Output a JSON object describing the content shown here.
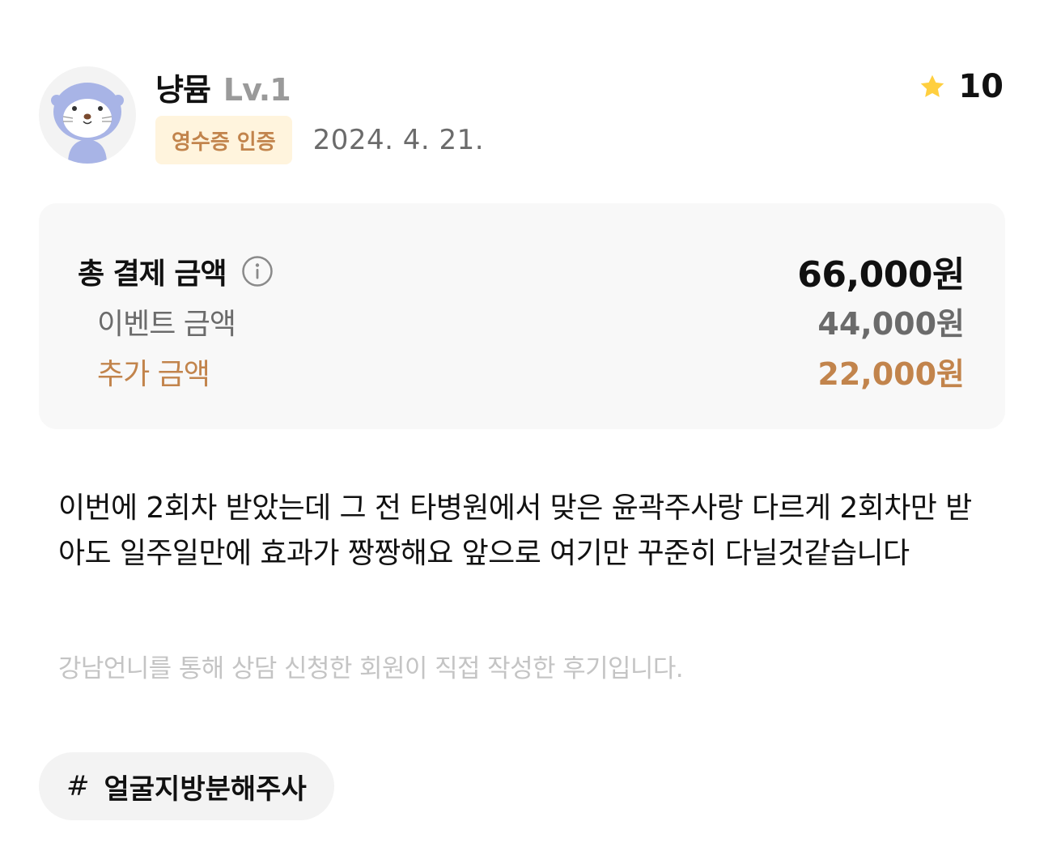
{
  "user": {
    "nickname": "냥뮴",
    "level": "Lv.1",
    "avatar_icon": "cat-character-avatar"
  },
  "badge": {
    "label": "영수증 인증"
  },
  "date": "2024. 4. 21.",
  "rating": {
    "icon": "star-icon",
    "value": "10"
  },
  "payment": {
    "total_label": "총 결제 금액",
    "total_value": "66,000원",
    "info_icon": "info-icon",
    "event_label": "이벤트 금액",
    "event_value": "44,000원",
    "extra_label": "추가 금액",
    "extra_value": "22,000원"
  },
  "review": {
    "text": "이번에 2회차 받았는데 그 전 타병원에서 맞은 윤곽주사랑 다르게 2회차만 받아도 일주일만에 효과가 짱짱해요 앞으로 여기만 꾸준히 다닐것같습니다",
    "disclaimer": "강남언니를 통해 상담 신청한 회원이 직접 작성한 후기입니다."
  },
  "tag": {
    "hash": "#",
    "label": "얼굴지방분해주사"
  },
  "colors": {
    "accent_brown": "#c2844c",
    "badge_bg": "#fff4dd",
    "star": "#ffcf3f",
    "muted": "#6b6b6b",
    "box_bg": "#f8f8f8"
  }
}
